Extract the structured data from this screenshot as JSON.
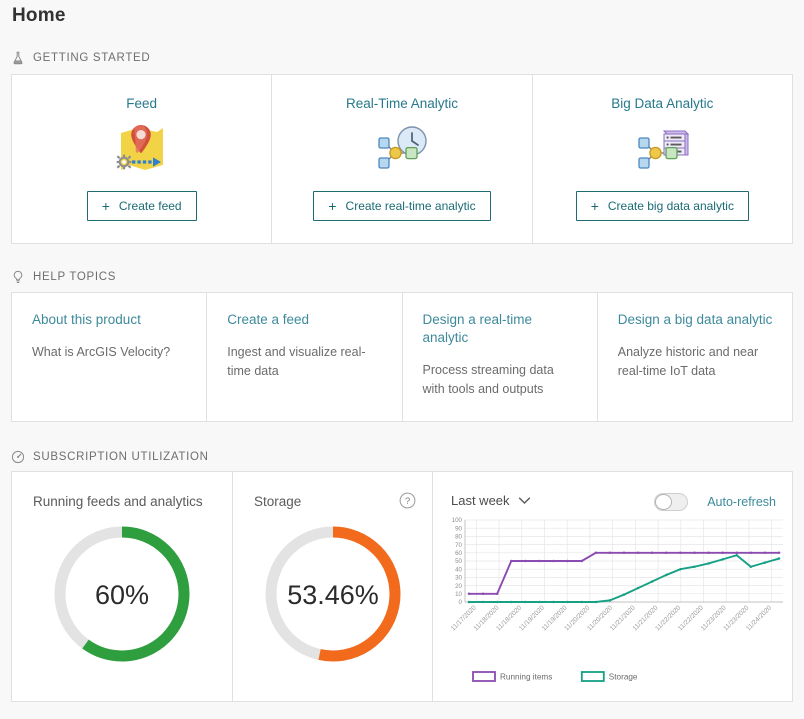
{
  "page": {
    "title": "Home"
  },
  "sections": {
    "getting_started": {
      "label": "GETTING STARTED",
      "icon": "flask-icon"
    },
    "help_topics": {
      "label": "HELP TOPICS",
      "icon": "lightbulb-icon"
    },
    "subscription": {
      "label": "SUBSCRIPTION UTILIZATION",
      "icon": "gauge-icon"
    }
  },
  "getting_started": {
    "cards": [
      {
        "title": "Feed",
        "icon": "feed-map-pin-icon",
        "button_label": "Create feed",
        "plus": "+"
      },
      {
        "title": "Real-Time Analytic",
        "icon": "realtime-clock-nodes-icon",
        "button_label": "Create real-time analytic",
        "plus": "+"
      },
      {
        "title": "Big Data Analytic",
        "icon": "bigdata-server-nodes-icon",
        "button_label": "Create big data analytic",
        "plus": "+"
      }
    ]
  },
  "help_topics": {
    "cards": [
      {
        "link": "About this product",
        "desc": "What is ArcGIS Velocity?"
      },
      {
        "link": "Create a feed",
        "desc": "Ingest and visualize real-time data"
      },
      {
        "link": "Design a real-time analytic",
        "desc": "Process streaming data with tools and outputs"
      },
      {
        "link": "Design a big data analytic",
        "desc": "Analyze historic and near real-time IoT data"
      }
    ]
  },
  "subscription": {
    "running": {
      "title": "Running feeds and analytics",
      "value_label": "60%",
      "percent": 60,
      "color": "#2e9e3e",
      "track_color": "#e3e3e3"
    },
    "storage": {
      "title": "Storage",
      "value_label": "53.46%",
      "percent": 53.46,
      "color": "#f26b1d",
      "track_color": "#e3e3e3",
      "help_icon": "question-circle-icon"
    },
    "chart_panel": {
      "range_label": "Last week",
      "range_caret": "chevron-down-icon",
      "autorefresh_label": "Auto-refresh",
      "autorefresh_on": false
    }
  },
  "chart_data": {
    "type": "line",
    "title": "",
    "xlabel": "",
    "ylabel": "",
    "ylim": [
      0,
      100
    ],
    "yticks": [
      0,
      10,
      20,
      30,
      40,
      50,
      60,
      70,
      80,
      90,
      100
    ],
    "grid": true,
    "legend_position": "bottom",
    "x": [
      "11/17/2020",
      "11/18/2020",
      "11/18/2020",
      "11/19/2020",
      "11/19/2020",
      "11/20/2020",
      "11/20/2020",
      "11/21/2020",
      "11/21/2020",
      "11/22/2020",
      "11/22/2020",
      "11/23/2020",
      "11/23/2020",
      "11/24/2020"
    ],
    "x_points": [
      "11/17/2020",
      "11/17/2020",
      "11/18/2020",
      "11/18/2020",
      "11/18/2020",
      "11/19/2020",
      "11/19/2020",
      "11/19/2020",
      "11/20/2020",
      "11/20/2020",
      "11/20/2020",
      "11/21/2020",
      "11/21/2020",
      "11/21/2020",
      "11/22/2020",
      "11/22/2020",
      "11/22/2020",
      "11/23/2020",
      "11/23/2020",
      "11/23/2020",
      "11/24/2020",
      "11/24/2020",
      "11/24/2020"
    ],
    "series": [
      {
        "name": "Running items",
        "color": "#8c4bb0",
        "values": [
          10,
          10,
          10,
          50,
          50,
          50,
          50,
          50,
          50,
          60,
          60,
          60,
          60,
          60,
          60,
          60,
          60,
          60,
          60,
          60,
          60,
          60,
          60
        ]
      },
      {
        "name": "Storage",
        "color": "#16a085",
        "values": [
          0,
          0,
          0,
          0,
          0,
          0,
          0,
          0,
          0,
          0,
          2,
          9,
          17,
          25,
          33,
          40,
          43,
          47,
          52,
          57,
          43,
          48,
          53
        ]
      }
    ]
  }
}
